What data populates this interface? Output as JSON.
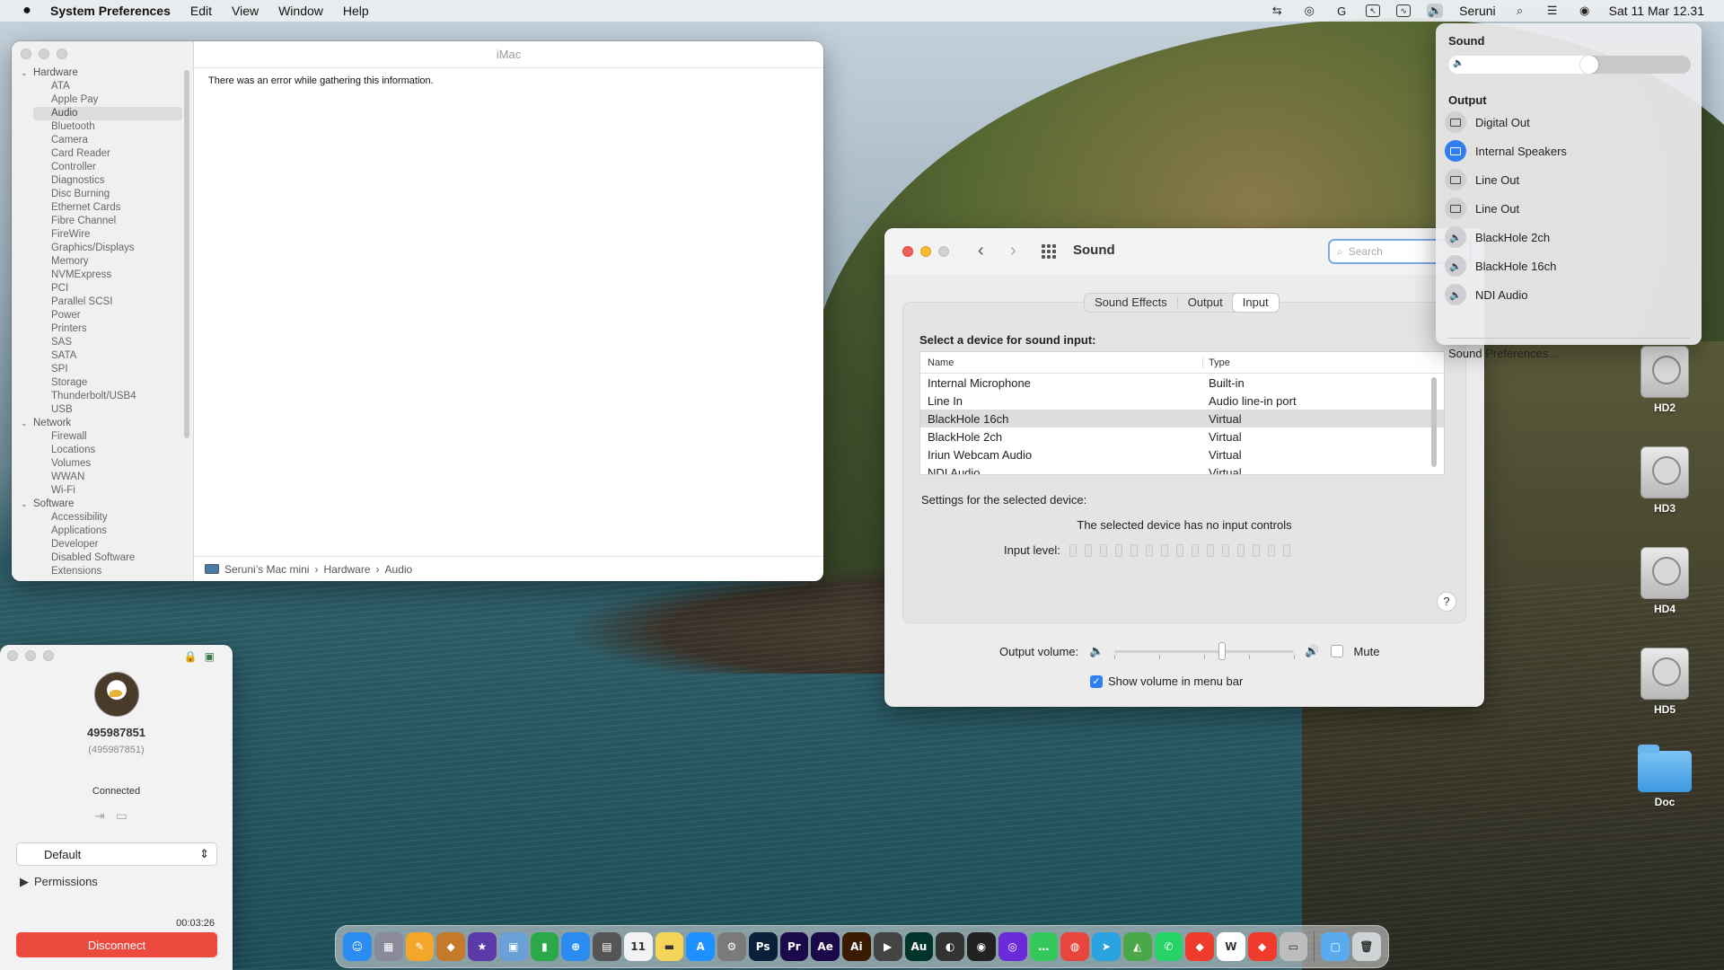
{
  "menubar": {
    "apple_icon": "apple-icon",
    "app_name": "System Preferences",
    "menus": [
      "Edit",
      "View",
      "Window",
      "Help"
    ],
    "user": "Seruni",
    "datetime": "Sat 11 Mar  12.31"
  },
  "sysinfo": {
    "window_title": "iMac",
    "message": "There was an error while gathering this information.",
    "sections": [
      {
        "label": "Hardware",
        "items": [
          "ATA",
          "Apple Pay",
          "Audio",
          "Bluetooth",
          "Camera",
          "Card Reader",
          "Controller",
          "Diagnostics",
          "Disc Burning",
          "Ethernet Cards",
          "Fibre Channel",
          "FireWire",
          "Graphics/Displays",
          "Memory",
          "NVMExpress",
          "PCI",
          "Parallel SCSI",
          "Power",
          "Printers",
          "SAS",
          "SATA",
          "SPI",
          "Storage",
          "Thunderbolt/USB4",
          "USB"
        ]
      },
      {
        "label": "Network",
        "items": [
          "Firewall",
          "Locations",
          "Volumes",
          "WWAN",
          "Wi-Fi"
        ]
      },
      {
        "label": "Software",
        "items": [
          "Accessibility",
          "Applications",
          "Developer",
          "Disabled Software",
          "Extensions"
        ]
      }
    ],
    "selected_item": "Audio",
    "path": {
      "computer": "Seruni’s Mac mini",
      "sep1": "›",
      "section": "Hardware",
      "sep2": "›",
      "item": "Audio"
    }
  },
  "sound": {
    "title": "Sound",
    "search_placeholder": "Search",
    "tabs": [
      "Sound Effects",
      "Output",
      "Input"
    ],
    "active_tab": "Input",
    "heading": "Select a device for sound input:",
    "columns": {
      "name": "Name",
      "type": "Type"
    },
    "rows": [
      {
        "name": "Internal Microphone",
        "type": "Built-in"
      },
      {
        "name": "Line In",
        "type": "Audio line-in port"
      },
      {
        "name": "BlackHole 16ch",
        "type": "Virtual"
      },
      {
        "name": "BlackHole 2ch",
        "type": "Virtual"
      },
      {
        "name": "Iriun Webcam Audio",
        "type": "Virtual"
      },
      {
        "name": "NDI Audio",
        "type": "Virtual"
      }
    ],
    "selected_row": 2,
    "settings_label": "Settings for the selected device:",
    "no_controls": "The selected device has no input controls",
    "input_level_label": "Input level:",
    "input_level": 0,
    "help": "?",
    "output_volume_label": "Output volume:",
    "output_volume": 0.6,
    "mute_label": "Mute",
    "mute": false,
    "show_volume_label": "Show volume in menu bar",
    "show_volume": true
  },
  "dropdown": {
    "sound_heading": "Sound",
    "volume": 0.62,
    "output_heading": "Output",
    "devices": [
      {
        "label": "Digital Out",
        "icon": "display-icon",
        "active": false
      },
      {
        "label": "Internal Speakers",
        "icon": "display-icon",
        "active": true
      },
      {
        "label": "Line Out",
        "icon": "display-icon",
        "active": false
      },
      {
        "label": "Line Out",
        "icon": "display-icon",
        "active": false
      },
      {
        "label": "BlackHole 2ch",
        "icon": "speaker-icon",
        "active": false
      },
      {
        "label": "BlackHole 16ch",
        "icon": "speaker-icon",
        "active": false
      },
      {
        "label": "NDI Audio",
        "icon": "speaker-icon",
        "active": false
      }
    ],
    "prefs_link": "Sound Preferences..."
  },
  "desktop": {
    "drives": [
      "HD2",
      "HD3",
      "HD4",
      "HD5"
    ],
    "folder": "Doc"
  },
  "remote": {
    "user_id": "495987851",
    "user_id_sub": "(495987851)",
    "status": "Connected",
    "mode": "Default",
    "permissions": "Permissions",
    "timer": "00:03:26",
    "disconnect": "Disconnect"
  },
  "dock": {
    "apps": [
      {
        "name": "finder",
        "label": "☺",
        "color": "#2a8cf0"
      },
      {
        "name": "launchpad",
        "label": "▦",
        "color": "#8a8a9a"
      },
      {
        "name": "pages",
        "label": "✎",
        "color": "#f4a62a"
      },
      {
        "name": "archiver",
        "label": "◆",
        "color": "#c47a2a"
      },
      {
        "name": "imovie",
        "label": "★",
        "color": "#5a3aa8"
      },
      {
        "name": "preview",
        "label": "▣",
        "color": "#6aa0d8"
      },
      {
        "name": "numbers",
        "label": "▮",
        "color": "#2aa84a"
      },
      {
        "name": "safari",
        "label": "⊕",
        "color": "#2a8cf0"
      },
      {
        "name": "calculator",
        "label": "▤",
        "color": "#555555"
      },
      {
        "name": "calendar",
        "label": "11",
        "color": "#f2f2f2"
      },
      {
        "name": "notes",
        "label": "▬",
        "color": "#f5d45a"
      },
      {
        "name": "app-store",
        "label": "A",
        "color": "#1e90ff"
      },
      {
        "name": "system-preferences",
        "label": "⚙",
        "color": "#7a7a7a"
      },
      {
        "name": "photoshop",
        "label": "Ps",
        "color": "#0a1f3a"
      },
      {
        "name": "premiere",
        "label": "Pr",
        "color": "#1a0a4a"
      },
      {
        "name": "after-effects",
        "label": "Ae",
        "color": "#1a0a4a"
      },
      {
        "name": "illustrator",
        "label": "Ai",
        "color": "#3a1a00"
      },
      {
        "name": "final-cut",
        "label": "▶",
        "color": "#444444"
      },
      {
        "name": "audition",
        "label": "Au",
        "color": "#00332a"
      },
      {
        "name": "compressor",
        "label": "◐",
        "color": "#333333"
      },
      {
        "name": "davinci",
        "label": "◉",
        "color": "#222222"
      },
      {
        "name": "obs",
        "label": "◎",
        "color": "#6a2ad8"
      },
      {
        "name": "messages",
        "label": "…",
        "color": "#34c759"
      },
      {
        "name": "chrome",
        "label": "◍",
        "color": "#e8453c"
      },
      {
        "name": "telegram",
        "label": "➤",
        "color": "#2aa3e0"
      },
      {
        "name": "maps",
        "label": "◭",
        "color": "#4aa84a"
      },
      {
        "name": "whatsapp",
        "label": "✆",
        "color": "#25d366"
      },
      {
        "name": "anydesk",
        "label": "◆",
        "color": "#ef3b2c"
      },
      {
        "name": "word",
        "label": "W",
        "color": "#ffffff"
      },
      {
        "name": "anydesk-2",
        "label": "◆",
        "color": "#ef3b2c"
      },
      {
        "name": "printer",
        "label": "▭",
        "color": "#bdbdbd"
      },
      {
        "name": "downloads-folder",
        "label": "▢",
        "color": "#5aaaf0"
      },
      {
        "name": "trash",
        "label": "🗑",
        "color": "#cfd3d6"
      }
    ]
  }
}
